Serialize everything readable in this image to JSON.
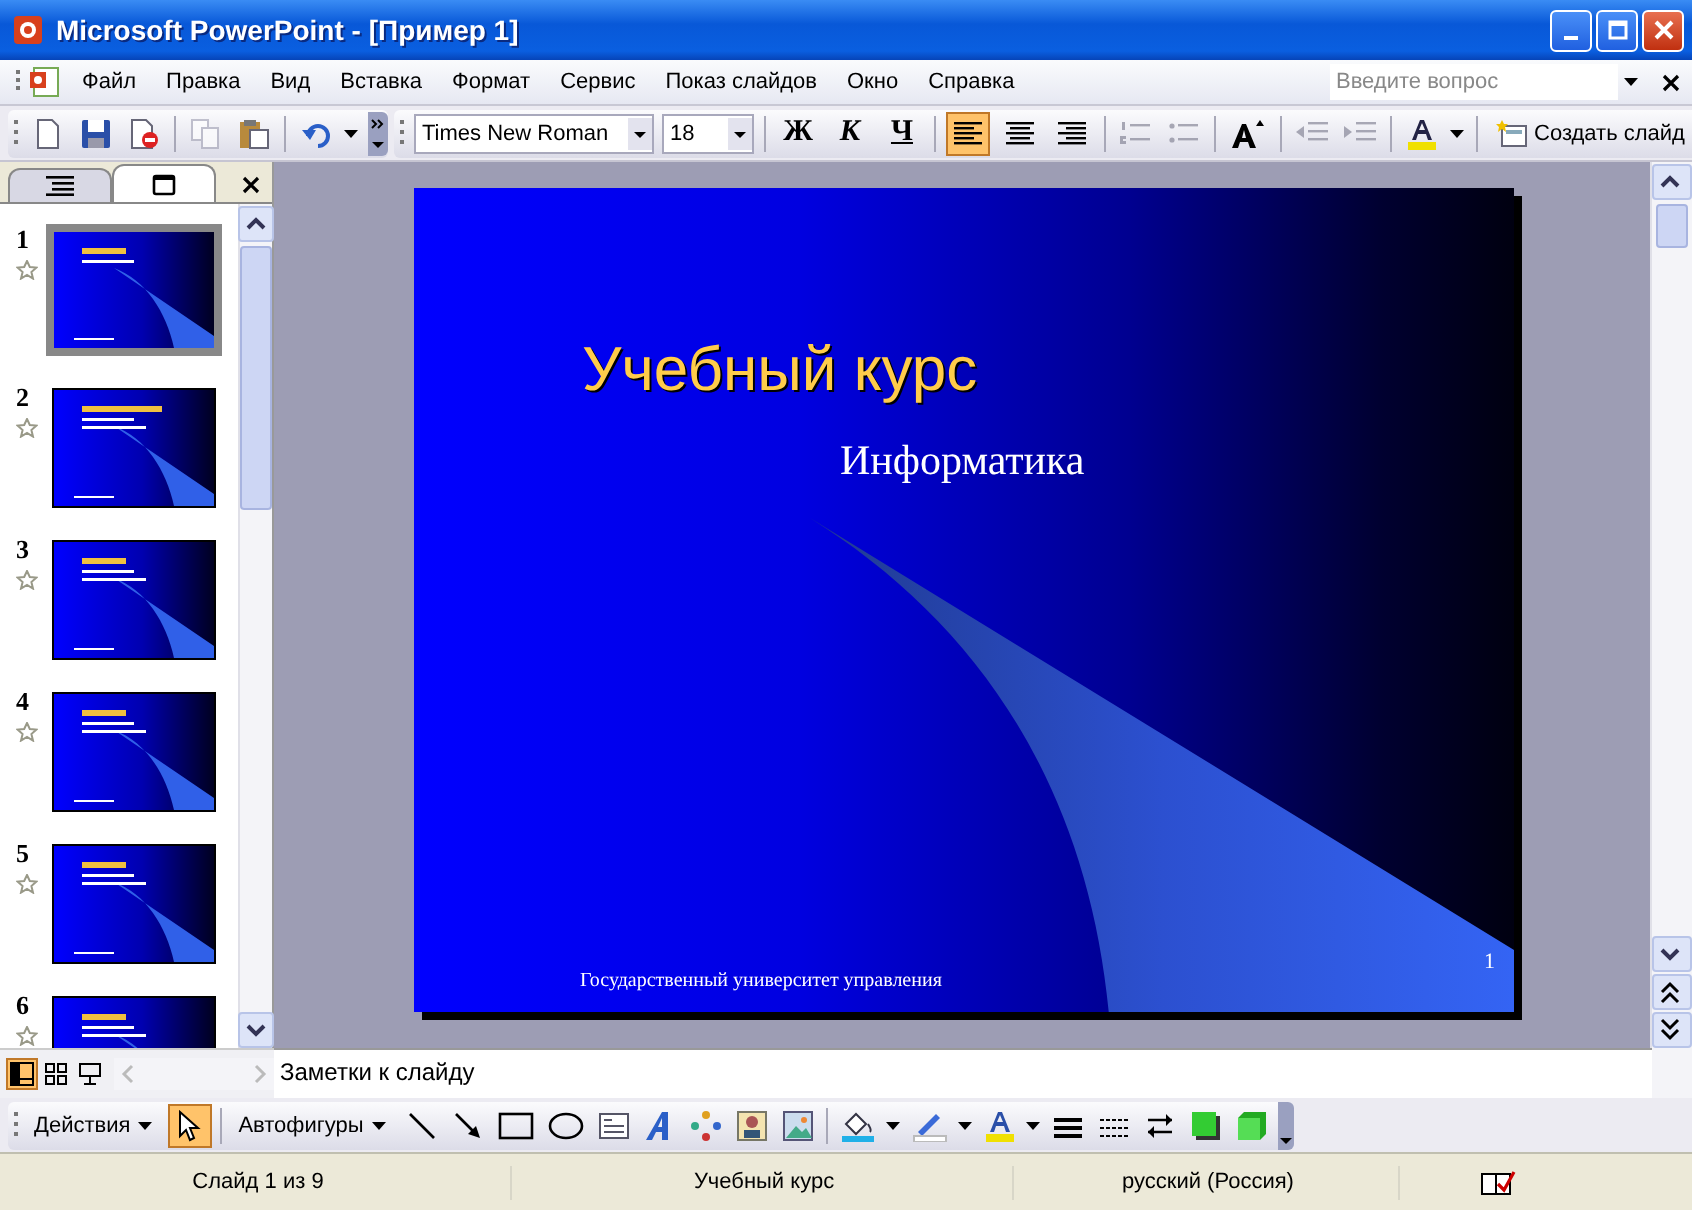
{
  "window": {
    "title": "Microsoft PowerPoint - [Пример 1]"
  },
  "menu": [
    "Файл",
    "Правка",
    "Вид",
    "Вставка",
    "Формат",
    "Сервис",
    "Показ слайдов",
    "Окно",
    "Справка"
  ],
  "help_search": {
    "placeholder": "Введите вопрос"
  },
  "formatting": {
    "font": "Times New Roman",
    "size": "18",
    "bold": "Ж",
    "italic": "К",
    "underline": "Ч",
    "new_slide": "Создать слайд"
  },
  "align_buttons": [
    {
      "kind": "left",
      "selected": true
    },
    {
      "kind": "center",
      "selected": false
    },
    {
      "kind": "right",
      "selected": false
    }
  ],
  "panel_tabs": [
    {
      "kind": "outline",
      "selected": false
    },
    {
      "kind": "slides",
      "selected": true
    }
  ],
  "thumbnails": [
    {
      "number": "1",
      "selected": true
    },
    {
      "number": "2",
      "selected": false
    },
    {
      "number": "3",
      "selected": false
    },
    {
      "number": "4",
      "selected": false
    },
    {
      "number": "5",
      "selected": false
    },
    {
      "number": "6",
      "selected": false
    }
  ],
  "slide": {
    "title": "Учебный курс",
    "subtitle": "Информатика",
    "footer": "Государственный университет управления",
    "number": "1"
  },
  "notes": {
    "placeholder": "Заметки к слайду"
  },
  "view_buttons": [
    {
      "kind": "normal",
      "selected": true
    },
    {
      "kind": "sorter",
      "selected": false
    },
    {
      "kind": "show",
      "selected": false
    }
  ],
  "drawing_toolbar": {
    "actions": "Действия",
    "autoshapes": "Автофигуры",
    "select_tool": {
      "selected": true
    }
  },
  "status_bar": {
    "slide": "Слайд 1 из 9",
    "design": "Учебный курс",
    "language": "русский (Россия)"
  }
}
